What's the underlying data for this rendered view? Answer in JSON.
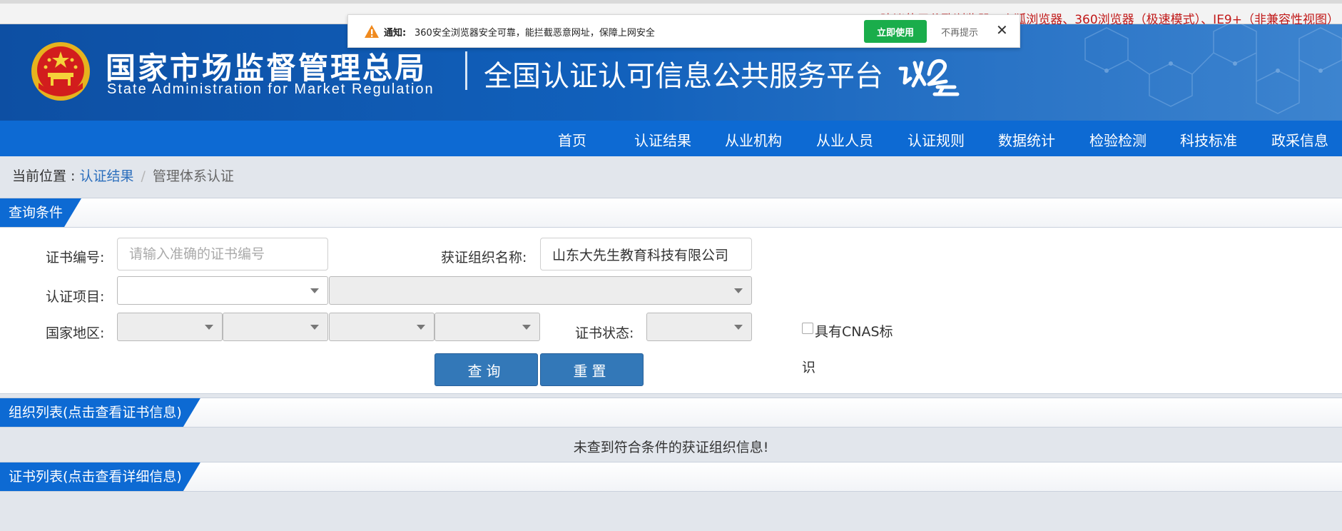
{
  "browser_tip": "建议使用谷歌浏览器、火狐浏览器、360浏览器（极速模式）、IE9+（非兼容性视图）",
  "notification": {
    "title": "通知:",
    "text": "360安全浏览器安全可靠，能拦截恶意网址，保障上网安全",
    "use_now": "立即使用",
    "dont_remind": "不再提示",
    "close": "✕"
  },
  "header": {
    "org_cn": "国家市场监督管理总局",
    "org_en": "State Administration  for  Market Regulation",
    "platform_title": "全国认证认可信息公共服务平台",
    "colors": {
      "primary": "#0d6ad3",
      "header_dark": "#0d4fa3"
    }
  },
  "nav": {
    "items": [
      "首页",
      "认证结果",
      "从业机构",
      "从业人员",
      "认证规则",
      "数据统计",
      "检验检测",
      "科技标准",
      "政采信息"
    ]
  },
  "breadcrumb": {
    "prefix": "当前位置 : ",
    "link": "认证结果",
    "separator": "/",
    "current": "管理体系认证"
  },
  "query": {
    "section_title": "查询条件",
    "cert_no_label": "证书编号:",
    "cert_no_placeholder": "请输入准确的证书编号",
    "org_name_label": "获证组织名称:",
    "org_name_value": "山东大先生教育科技有限公司",
    "cert_project_label": "认证项目:",
    "region_label": "国家地区:",
    "status_label": "证书状态:",
    "cnas_label_line1": "具有CNAS标",
    "cnas_label_line2": "识",
    "search_button": "查询",
    "reset_button": "重置"
  },
  "org_list": {
    "section_title": "组织列表(点击查看证书信息)",
    "empty_message": "未查到符合条件的获证组织信息!"
  },
  "cert_list": {
    "section_title": "证书列表(点击查看详细信息)"
  }
}
